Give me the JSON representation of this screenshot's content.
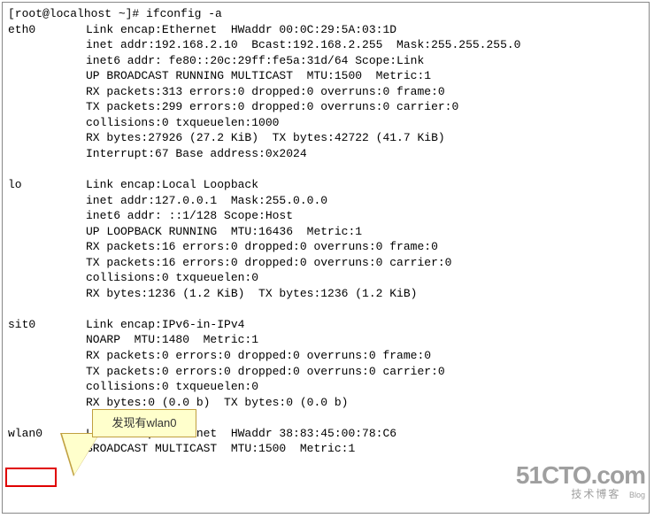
{
  "prompt": "[root@localhost ~]# ",
  "command": "ifconfig -a",
  "interfaces": [
    {
      "name": "eth0",
      "lines": [
        "Link encap:Ethernet  HWaddr 00:0C:29:5A:03:1D",
        "inet addr:192.168.2.10  Bcast:192.168.2.255  Mask:255.255.255.0",
        "inet6 addr: fe80::20c:29ff:fe5a:31d/64 Scope:Link",
        "UP BROADCAST RUNNING MULTICAST  MTU:1500  Metric:1",
        "RX packets:313 errors:0 dropped:0 overruns:0 frame:0",
        "TX packets:299 errors:0 dropped:0 overruns:0 carrier:0",
        "collisions:0 txqueuelen:1000",
        "RX bytes:27926 (27.2 KiB)  TX bytes:42722 (41.7 KiB)",
        "Interrupt:67 Base address:0x2024"
      ]
    },
    {
      "name": "lo",
      "lines": [
        "Link encap:Local Loopback",
        "inet addr:127.0.0.1  Mask:255.0.0.0",
        "inet6 addr: ::1/128 Scope:Host",
        "UP LOOPBACK RUNNING  MTU:16436  Metric:1",
        "RX packets:16 errors:0 dropped:0 overruns:0 frame:0",
        "TX packets:16 errors:0 dropped:0 overruns:0 carrier:0",
        "collisions:0 txqueuelen:0",
        "RX bytes:1236 (1.2 KiB)  TX bytes:1236 (1.2 KiB)"
      ]
    },
    {
      "name": "sit0",
      "lines": [
        "Link encap:IPv6-in-IPv4",
        "NOARP  MTU:1480  Metric:1",
        "RX packets:0 errors:0 dropped:0 overruns:0 frame:0",
        "TX packets:0 errors:0 dropped:0 overruns:0 carrier:0",
        "collisions:0 txqueuelen:0",
        "RX bytes:0 (0.0 b)  TX bytes:0 (0.0 b)"
      ]
    },
    {
      "name": "wlan0",
      "lines": [
        "Link encap:Ethernet  HWaddr 38:83:45:00:78:C6",
        "BROADCAST MULTICAST  MTU:1500  Metric:1"
      ]
    }
  ],
  "callout_text": "发现有wlan0",
  "watermark": {
    "main": "51CTO.com",
    "sub": "技术博客",
    "blog": "Blog"
  }
}
